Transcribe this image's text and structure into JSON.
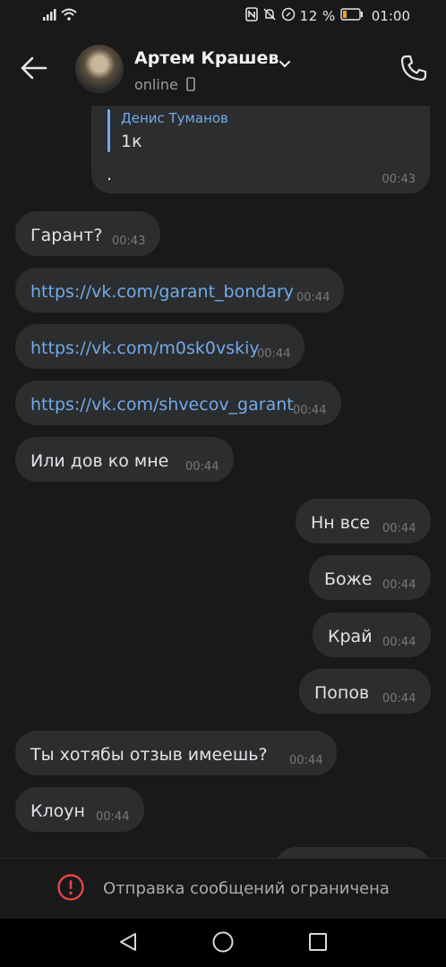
{
  "status_bar": {
    "battery_percent": "12 %",
    "time": "01:00",
    "icons": [
      "signal-icon",
      "wifi-icon",
      "nfc-icon",
      "mute-icon",
      "data-saver-icon",
      "battery-icon"
    ]
  },
  "header": {
    "contact_name": "Артем Крашев",
    "status": "online",
    "icons": [
      "back-arrow-icon",
      "chevron-down-icon",
      "mobile-icon",
      "phone-call-icon"
    ]
  },
  "quoted": {
    "author": "Денис Туманов",
    "text": "1к",
    "body": ".",
    "time": "00:43"
  },
  "messages": [
    {
      "text": "Гарант?",
      "time": "00:43",
      "dir": "in",
      "link": false
    },
    {
      "text": "https://vk.com/garant_bondary",
      "time": "00:44",
      "dir": "in",
      "link": true
    },
    {
      "text": "https://vk.com/m0sk0vskiy",
      "time": "00:44",
      "dir": "in",
      "link": true
    },
    {
      "text": "https://vk.com/shvecov_garant",
      "time": "00:44",
      "dir": "in",
      "link": true
    },
    {
      "text": "Или дов ко мне",
      "time": "00:44",
      "dir": "in",
      "link": false
    },
    {
      "text": "Нн все",
      "time": "00:44",
      "dir": "out",
      "link": false
    },
    {
      "text": "Боже",
      "time": "00:44",
      "dir": "out",
      "link": false
    },
    {
      "text": "Край",
      "time": "00:44",
      "dir": "out",
      "link": false
    },
    {
      "text": "Попов",
      "time": "00:44",
      "dir": "out",
      "link": false
    },
    {
      "text": "Ты хотябы отзыв имеешь?",
      "time": "00:44",
      "dir": "in",
      "link": false
    },
    {
      "text": "Клоун",
      "time": "00:44",
      "dir": "in",
      "link": false
    }
  ],
  "restriction": {
    "text": "Отправка сообщений ограничена",
    "icon": "alert-circle-icon",
    "color": "#e64646"
  },
  "nav_bar": {
    "icons": [
      "nav-back-icon",
      "nav-home-icon",
      "nav-recents-icon"
    ]
  },
  "colors": {
    "background": "#19191a",
    "bubble": "#2c2d2e",
    "link": "#71aaeb",
    "time": "#76787a"
  }
}
